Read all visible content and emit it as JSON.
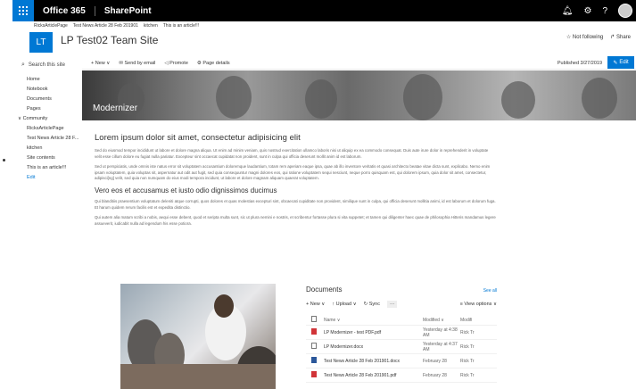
{
  "suite": {
    "app": "Office 365",
    "product": "SharePoint",
    "icons": [
      "bell-icon",
      "gear-icon",
      "help-icon"
    ]
  },
  "breadcrumb": [
    "RicksArticlePage",
    "Test News Article 28 Feb 201901",
    "kitchen",
    "This is an article!!!"
  ],
  "site": {
    "logo": "LT",
    "title": "LP Test02 Team Site",
    "follow": "Not following",
    "share": "Share"
  },
  "search": {
    "placeholder": "Search this site"
  },
  "nav": {
    "items": [
      "Home",
      "Notebook",
      "Documents",
      "Pages"
    ],
    "group": "Community",
    "more": [
      "RicksArticlePage",
      "Test News Article 28 F...",
      "kitchen",
      "Site contents",
      "This is an article!!!"
    ],
    "edit": "Edit"
  },
  "command": {
    "new": "New",
    "send": "Send by email",
    "promote": "Promote",
    "details": "Page details",
    "published": "Published 3/27/2019",
    "edit": "Edit"
  },
  "hero": {
    "title": "Modernizer"
  },
  "article": {
    "h1": "Lorem ipsum dolor sit amet, consectetur adipisicing elit",
    "p1": "Sed do eiusmod tempor incididunt ut labore et dolore magna aliqua. Ut enim ad minim veniam, quis nostrud exercitation ullamco laboris nisi ut aliquip ex ea commodo consequat. Duis aute irure dolor in reprehenderit in voluptate velit esse cillum dolore eu fugiat nulla pariatur. Excepteur sint occaecat cupidatat non proident, sunt in culpa qui officia deserunt mollit anim id est laborum.",
    "p2": "Sed ut perspiciatis, unde omnis iste natus error sit voluptatem accusantium doloremque laudantium, totam rem aperiam eaque ipsa, quae ab illo inventore veritatis et quasi architecto beatae vitae dicta sunt, explicabo. Nemo enim ipsam voluptatem, quia voluptas sit, aspernatur aut odit aut fugit, sed quia consequuntur magni dolores eos, qui ratione voluptatem sequi nesciunt, neque porro quisquam est, qui dolorem ipsum, quia dolor sit amet, consectetur, adipisci[ng] velit, sed quia non numquam do eius modi tempora incidunt, ut labore et dolore magnam aliquam quaerat voluptatem.",
    "h2": "Vero eos et accusamus et iusto odio dignissimos ducimus",
    "p3": "Qui blanditiis praesentium voluptatum deleniti atque corrupti, quos dolores et quas molestias excepturi sint, obcaecati cupiditate non provident, similique sunt in culpa, qui officia deserunt mollitia animi, id est laborum et dolorum fuga. Et harum quidem rerum facilis est et expedita distinctio.",
    "p4": "Qui autem alia matum scribi a nobis, aequi esse debent, quod et seripta multa sunt, sic ut plura nemini e nostris, et scribentur fortasse plura si vita suppetet; et tamen qui diligenter haec quae de philosophia Hitteris mandamus legere assueverit, iudicabit nulla ad legendum his esse potiora."
  },
  "documents": {
    "title": "Documents",
    "see_all": "See all",
    "cmd": {
      "new": "New",
      "upload": "Upload",
      "sync": "Sync",
      "more": "···",
      "view": "View options"
    },
    "cols": {
      "name": "Name",
      "modified": "Modified",
      "modby": "Modifi"
    },
    "rows": [
      {
        "type": "pdf",
        "name": "LP Modernizer - test PDF.pdf",
        "modified": "Yesterday at 4:38 AM",
        "by": "Rick Tr"
      },
      {
        "type": "file",
        "name": "LP Modernizer.docx",
        "modified": "Yesterday at 4:37 AM",
        "by": "Rick Tr"
      },
      {
        "type": "docx",
        "name": "Test News Article 28 Feb 201901.docx",
        "modified": "February 28",
        "by": "Rick Tr"
      },
      {
        "type": "pdf",
        "name": "Test News Article 28 Feb 201901.pdf",
        "modified": "February 28",
        "by": "Rick Tr"
      }
    ]
  }
}
